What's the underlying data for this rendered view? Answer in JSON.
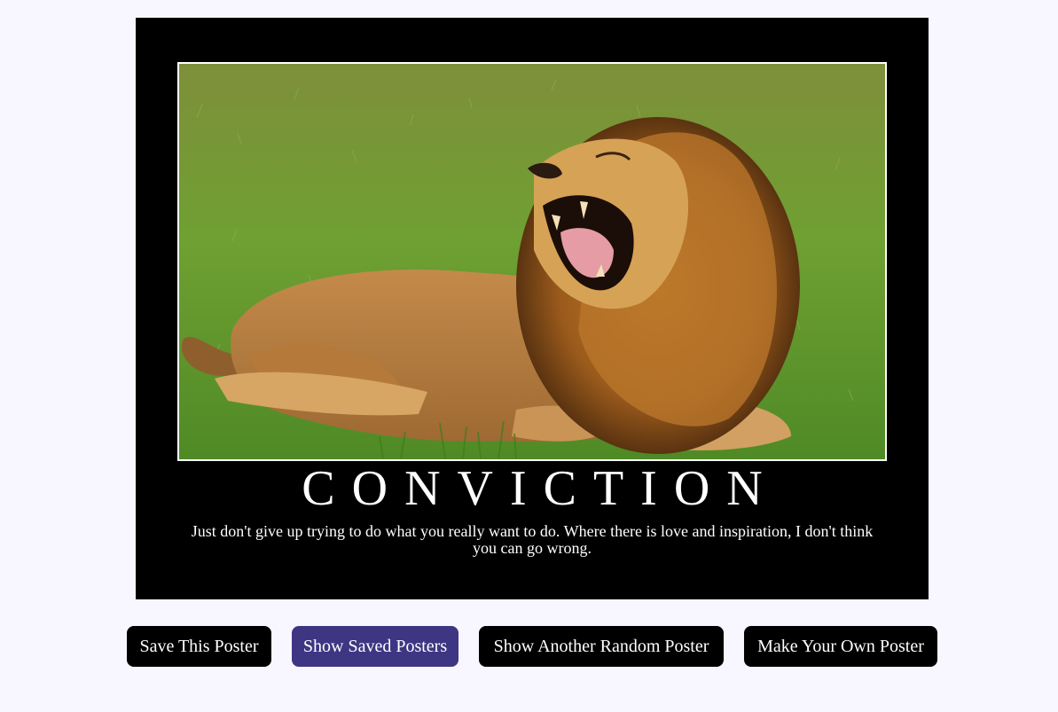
{
  "poster": {
    "image_subject": "lion-roaring-on-grass",
    "title": "CONVICTION",
    "quote": "Just don't give up trying to do what you really want to do. Where there is love and inspiration, I don't think you can go wrong."
  },
  "buttons": {
    "save": "Save This Poster",
    "show_saved": "Show Saved Posters",
    "show_random": "Show Another Random Poster",
    "make_own": "Make Your Own Poster"
  },
  "colors": {
    "page_background": "#f8f7ff",
    "poster_background": "#000000",
    "button_background": "#000000",
    "accent_button": "#3f3683",
    "text_on_dark": "#ffffff"
  }
}
